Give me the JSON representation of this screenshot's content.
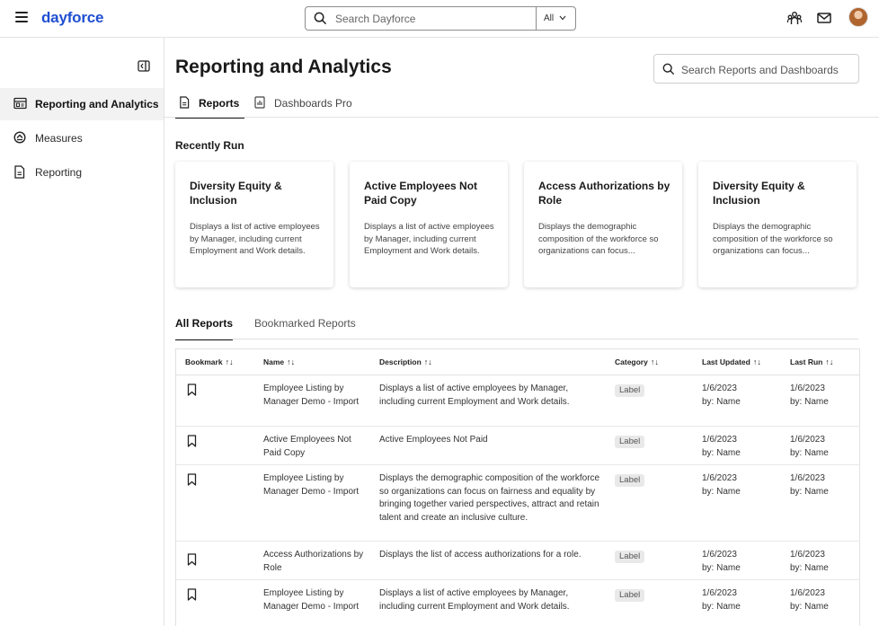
{
  "header": {
    "logo_text": "dayforce",
    "search_placeholder": "Search Dayforce",
    "search_scope": "All",
    "icons": [
      "menu-icon",
      "people-icon",
      "mail-icon",
      "avatar"
    ]
  },
  "sidebar": {
    "items": [
      {
        "label": "Reporting and Analytics",
        "icon": "report-icon",
        "active": true
      },
      {
        "label": "Measures",
        "icon": "measures-icon",
        "active": false
      },
      {
        "label": "Reporting",
        "icon": "document-icon",
        "active": false
      }
    ]
  },
  "main": {
    "title": "Reporting and Analytics",
    "search_placeholder": "Search Reports and Dashboards",
    "tabs": [
      {
        "label": "Reports",
        "active": true
      },
      {
        "label": "Dashboards Pro",
        "active": false
      }
    ],
    "recent_label": "Recently Run",
    "cards": [
      {
        "title": "Diversity Equity & Inclusion",
        "desc": "Displays a list of active employees by Manager, including current Employment and Work details."
      },
      {
        "title": "Active Employees Not Paid Copy",
        "desc": "Displays a list of active employees by Manager, including current Employment and Work details."
      },
      {
        "title": "Access Authorizations by Role",
        "desc": "Displays the demographic composition of the workforce so organizations can focus..."
      },
      {
        "title": "Diversity Equity & Inclusion",
        "desc": "Displays the demographic composition of the workforce so organizations can focus..."
      }
    ],
    "sub_tabs": [
      {
        "label": "All Reports",
        "active": true
      },
      {
        "label": "Bookmarked Reports",
        "active": false
      }
    ],
    "table": {
      "columns": [
        "Bookmark",
        "Name",
        "Description",
        "Category",
        "Last Updated",
        "Last Run"
      ],
      "sort_glyph": "↑↓",
      "rows": [
        {
          "name": "Employee Listing by Manager Demo - Import",
          "description": "Displays a list of active employees by Manager, including current Employment and Work details.",
          "category": "Label",
          "updated_date": "1/6/2023",
          "updated_by": "by: Name",
          "run_date": "1/6/2023",
          "run_by": "by: Name"
        },
        {
          "name": "Active Employees Not Paid Copy",
          "description": "Active Employees Not Paid",
          "category": "Label",
          "updated_date": "1/6/2023",
          "updated_by": "by: Name",
          "run_date": "1/6/2023",
          "run_by": "by: Name"
        },
        {
          "name": "Employee Listing by Manager Demo - Import",
          "description": "Displays the demographic composition of the workforce so organizations can focus on fairness and equality by bringing together varied perspectives, attract and retain talent and create an inclusive culture.",
          "category": "Label",
          "updated_date": "1/6/2023",
          "updated_by": "by: Name",
          "run_date": "1/6/2023",
          "run_by": "by: Name"
        },
        {
          "name": "Access Authorizations by Role",
          "description": "Displays the list of access authorizations for a role.",
          "category": "Label",
          "updated_date": "1/6/2023",
          "updated_by": "by: Name",
          "run_date": "1/6/2023",
          "run_by": "by: Name"
        },
        {
          "name": "Employee Listing by Manager Demo - Import",
          "description": "Displays a list of active employees by Manager, including current Employment and Work details.",
          "category": "Label",
          "updated_date": "1/6/2023",
          "updated_by": "by: Name",
          "run_date": "1/6/2023",
          "run_by": "by: Name"
        }
      ]
    }
  },
  "colors": {
    "brand": "#1f4fd1",
    "text": "#1a1a1a",
    "border": "#e3e3e3",
    "active_nav_bg": "#f2f2f2",
    "badge_bg": "#e9e9e9"
  }
}
